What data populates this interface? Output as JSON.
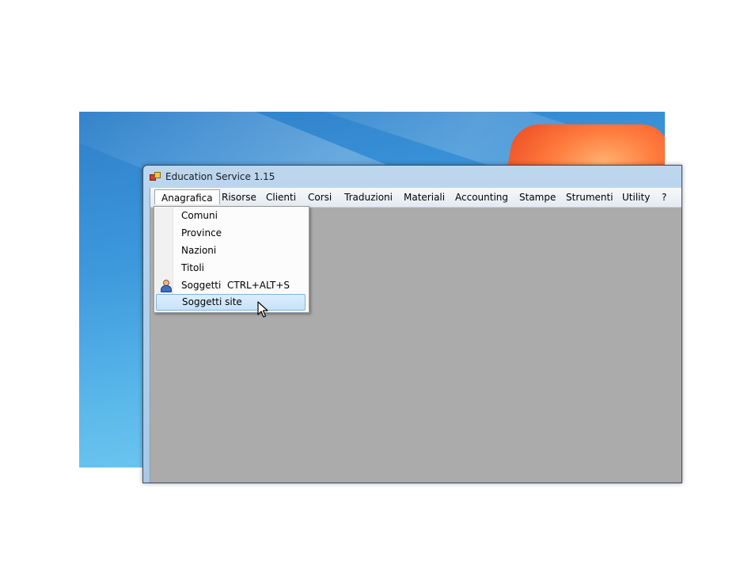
{
  "window": {
    "title": "Education Service 1.15"
  },
  "menubar": {
    "items": [
      {
        "label": "Anagrafica"
      },
      {
        "label": "Risorse"
      },
      {
        "label": "Clienti"
      },
      {
        "label": "Corsi"
      },
      {
        "label": "Traduzioni"
      },
      {
        "label": "Materiali"
      },
      {
        "label": "Accounting"
      },
      {
        "label": "Stampe"
      },
      {
        "label": "Strumenti"
      },
      {
        "label": "Utility"
      },
      {
        "label": "?"
      }
    ],
    "open_menu": "Anagrafica"
  },
  "dropdown": {
    "items": [
      {
        "label": "Comuni"
      },
      {
        "label": "Province"
      },
      {
        "label": "Nazioni"
      },
      {
        "label": "Titoli"
      },
      {
        "label": "Soggetti",
        "shortcut": "CTRL+ALT+S",
        "icon": "person-icon"
      },
      {
        "label": "Soggetti site",
        "highlighted": true
      }
    ]
  },
  "colors": {
    "client_background": "#ababab",
    "highlight": "#c6e2fb",
    "highlight_border": "#7fb4e6"
  }
}
